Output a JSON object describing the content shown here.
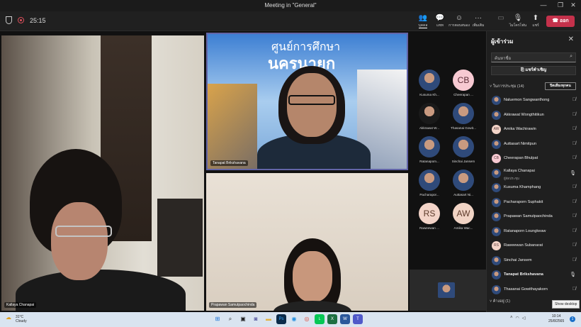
{
  "window": {
    "title": "Meeting in \"General\"",
    "controls": [
      "—",
      "❐",
      "✕"
    ]
  },
  "meeting": {
    "timer": "25:15",
    "shield_icon": "shield-icon",
    "record_icon": "record-icon"
  },
  "toolbar": {
    "people": {
      "label": "บุคคล",
      "icon": "people-icon"
    },
    "chat": {
      "label": "แชท",
      "icon": "chat-icon"
    },
    "reactions": {
      "label": "การตอบสนอง",
      "icon": "reactions-icon"
    },
    "more": {
      "label": "เพิ่มเติม",
      "icon": "more-icon"
    },
    "camera": {
      "label": "",
      "icon": "camera-off-icon"
    },
    "mic": {
      "label": "ไมโครโฟน",
      "icon": "mic-off-icon"
    },
    "share": {
      "label": "แชร์",
      "icon": "share-icon"
    },
    "leave": {
      "label": "ออก",
      "icon": "phone-icon"
    }
  },
  "stage": {
    "tiles": [
      {
        "name": "Kallaya Chanapai"
      },
      {
        "name": "Tanapat Brikshavana",
        "banner_line1": "ศูนย์การศึกษา",
        "banner_line2": "นครนายก"
      },
      {
        "name": "Prapawan Samutpaochinda"
      }
    ]
  },
  "gallery": [
    {
      "name": "Kusuma Kh...",
      "avatar": "photo"
    },
    {
      "name": "Cheerapan ...",
      "avatar": "CB"
    },
    {
      "name": "Akkrawat W...",
      "avatar": "photo"
    },
    {
      "name": "Thasanai Gowit...",
      "avatar": "photo"
    },
    {
      "name": "Ratanapom...",
      "avatar": "photo"
    },
    {
      "name": "Sinchai Jansem",
      "avatar": "photo"
    },
    {
      "name": "Pacharapor...",
      "avatar": "photo"
    },
    {
      "name": "Auttasart Ni...",
      "avatar": "photo"
    },
    {
      "name": "Raweewan ...",
      "avatar": "RS"
    },
    {
      "name": "Amika Wac...",
      "avatar": "AW"
    }
  ],
  "panel": {
    "title": "ผู้เข้าร่วม",
    "search_placeholder": "ค้นหาชื่อ",
    "share_invite": "แชร์คำเชิญ",
    "section_in_meeting": "ในการประชุม (14)",
    "mute_all": "ปิดเสียงทุกคน",
    "participants": [
      {
        "name": "Naluemon Sangwanthong",
        "avatar": "photo",
        "mic": "off"
      },
      {
        "name": "Akkrawat Wongthitikun",
        "avatar": "photo",
        "mic": "off"
      },
      {
        "name": "Amika Wachirawin",
        "avatar": "AW",
        "mic": "off"
      },
      {
        "name": "Auttasart Nimitpun",
        "avatar": "photo",
        "mic": "off"
      },
      {
        "name": "Cheerapan Bhulpat",
        "avatar": "CB",
        "mic": "off"
      },
      {
        "name": "Kallaya Chanapai",
        "sub": "ผู้จัดประชุม",
        "avatar": "photo",
        "mic": "on"
      },
      {
        "name": "Kusuma Khamphang",
        "avatar": "photo",
        "mic": "off"
      },
      {
        "name": "Pacharaporn Suphakit",
        "avatar": "photo",
        "mic": "off"
      },
      {
        "name": "Prapawan Samutpaochinda",
        "avatar": "photo",
        "mic": "off"
      },
      {
        "name": "Ratanaporn Loungkeaw",
        "avatar": "photo",
        "mic": "off"
      },
      {
        "name": "Raweewan Subanarat",
        "avatar": "RS",
        "mic": "off"
      },
      {
        "name": "Sinchai Jansem",
        "avatar": "photo",
        "mic": "off"
      },
      {
        "name": "Tanapat Brikshavana",
        "avatar": "photo",
        "mic": "on",
        "bold": true
      },
      {
        "name": "Thasanai Gowithayakorn",
        "avatar": "photo",
        "mic": "off"
      }
    ],
    "section_invited": "ค้างอยู่ (1)"
  },
  "tooltip": "Show desktop",
  "taskbar": {
    "weather_temp": "31°C",
    "weather_desc": "Cloudy",
    "time": "10:14",
    "date": "25/8/2565",
    "notifications": "1",
    "apps": [
      "windows-icon",
      "search-icon",
      "task-view-icon",
      "chat-icon",
      "explorer-icon",
      "photoshop-icon",
      "edge-icon",
      "chrome-icon",
      "line-icon",
      "excel-icon",
      "word-icon",
      "teams-icon"
    ]
  },
  "colors": {
    "accent": "#6264a7",
    "leave": "#c4314b",
    "panel_bg": "#1f1f1f"
  }
}
